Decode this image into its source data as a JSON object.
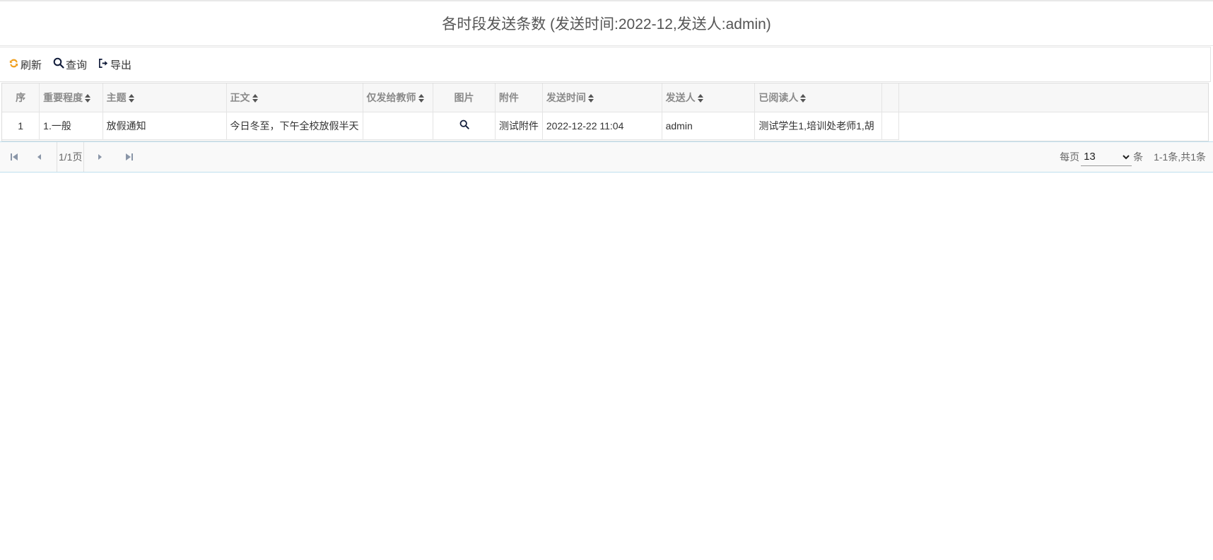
{
  "page": {
    "title": "各时段发送条数 (发送时间:2022-12,发送人:admin)"
  },
  "toolbar": {
    "refresh_label": "刷新",
    "query_label": "查询",
    "export_label": "导出",
    "accent_color": "#f0a020"
  },
  "table": {
    "headers": {
      "index": "序",
      "importance": "重要程度",
      "subject": "主题",
      "body": "正文",
      "teachers_only": "仅发给教师",
      "image": "图片",
      "attachment": "附件",
      "send_time": "发送时间",
      "sender": "发送人",
      "readers": "已阅读人"
    },
    "rows": [
      {
        "index": "1",
        "importance": "1.一般",
        "subject": "放假通知",
        "body": "今日冬至，下午全校放假半天",
        "teachers_only": "",
        "image": "search-icon",
        "attachment": "测试附件",
        "send_time": "2022-12-22 11:04",
        "sender": "admin",
        "readers": "测试学生1,培训处老师1,胡"
      }
    ]
  },
  "pager": {
    "page_info": "1/1页",
    "per_page_label": "每页",
    "per_page_value": "13",
    "per_page_unit": "条",
    "total_label": "1-1条,共1条"
  }
}
